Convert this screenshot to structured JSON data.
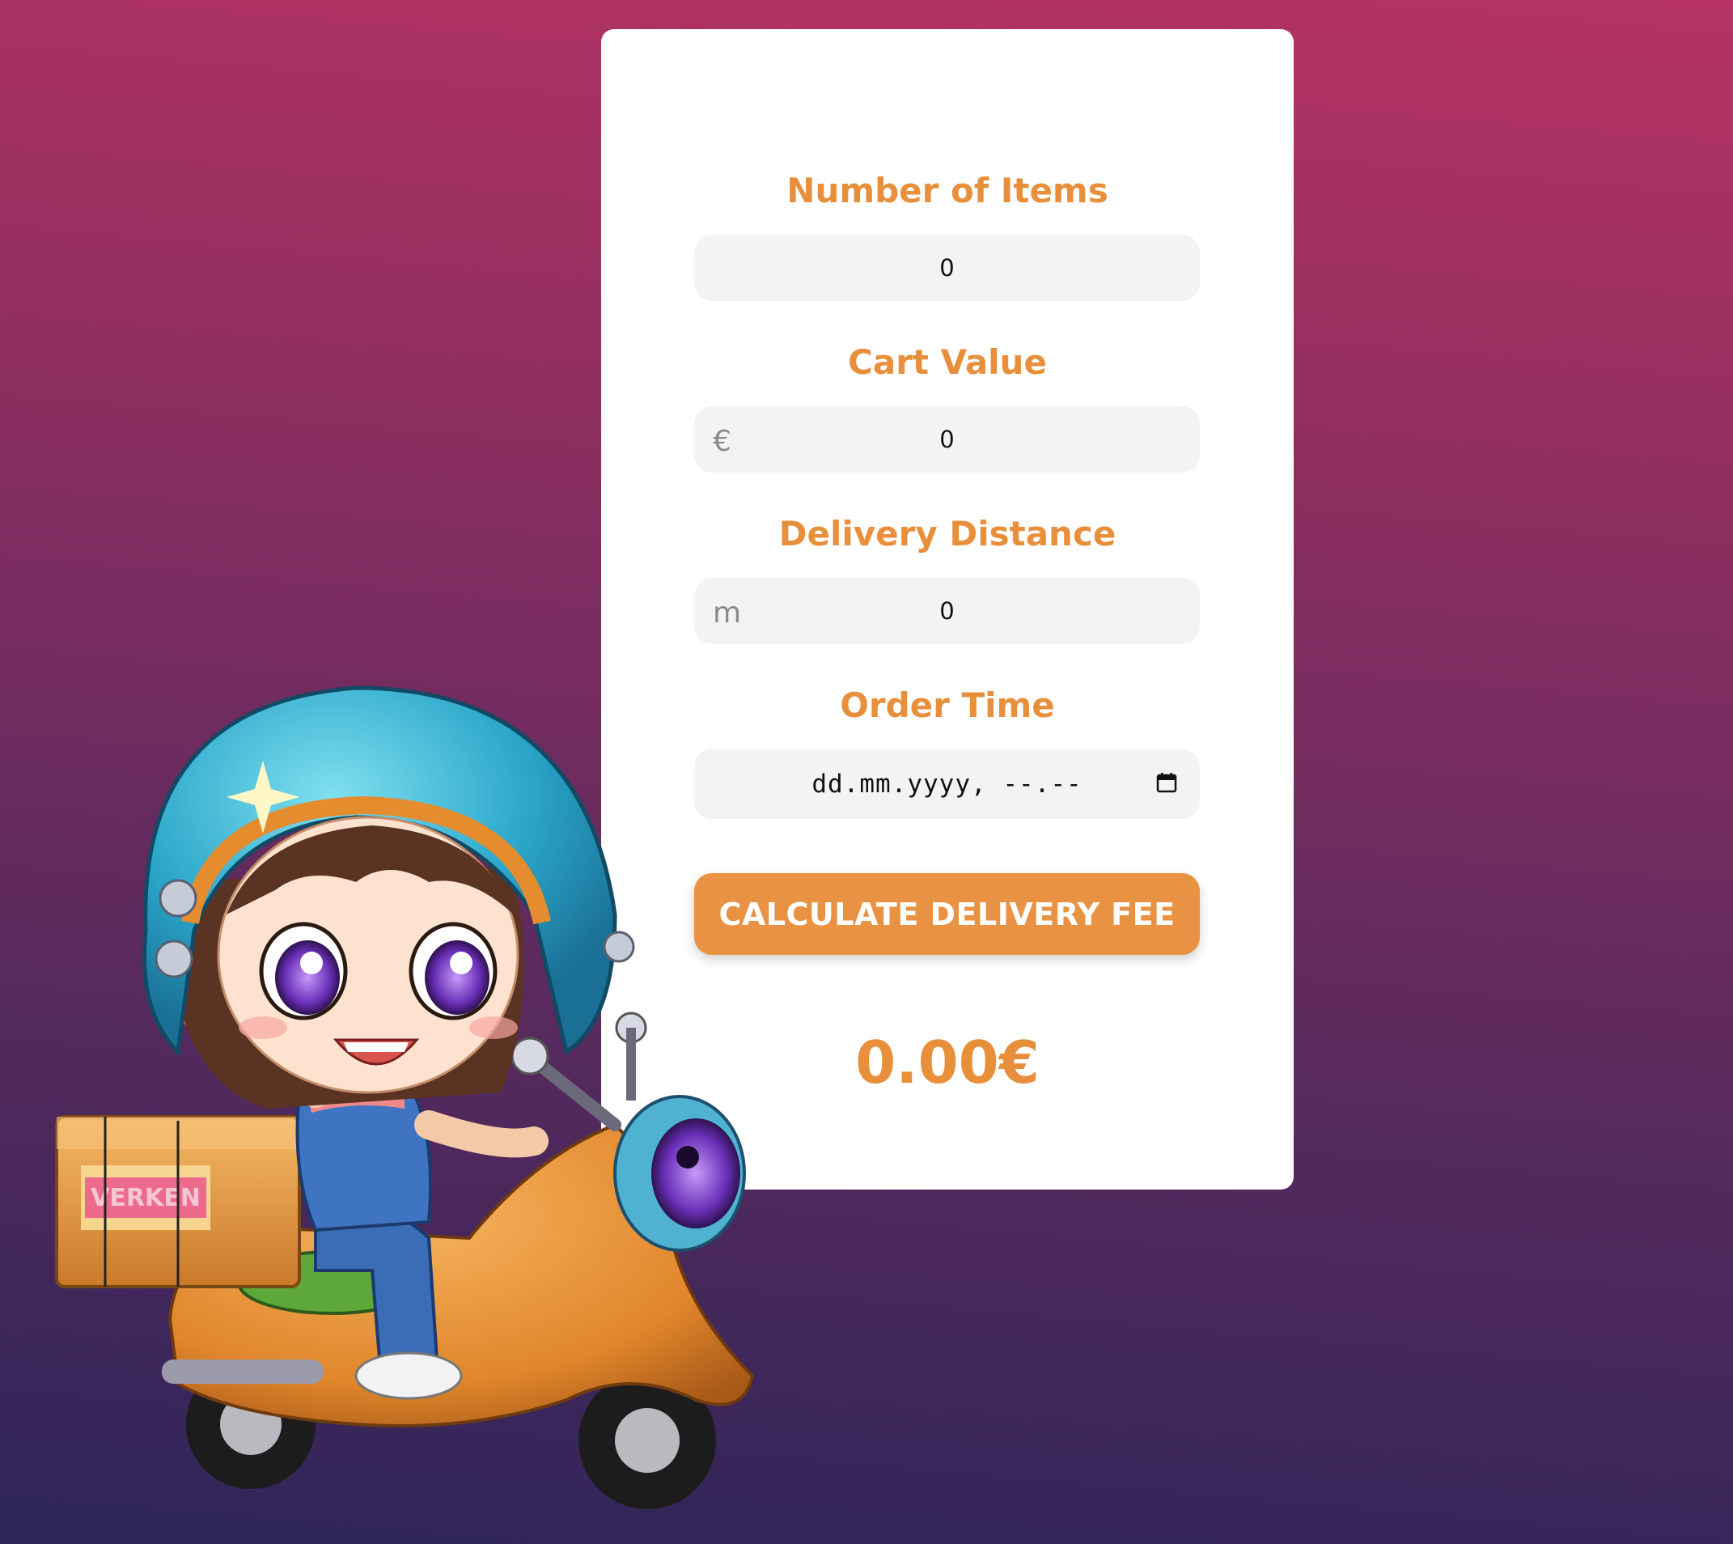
{
  "form": {
    "items": {
      "label": "Number of Items",
      "value": "0"
    },
    "cart": {
      "label": "Cart Value",
      "unit": "€",
      "value": "0"
    },
    "distance": {
      "label": "Delivery Distance",
      "unit": "m",
      "value": "0"
    },
    "time": {
      "label": "Order Time",
      "value": "dd.mm.yyyy, --.--"
    },
    "button_label": "CALCULATE DELIVERY FEE",
    "result": "0.00€"
  },
  "colors": {
    "accent": "#e88f3c",
    "button": "#ea9243",
    "input_bg": "#f2f4f3",
    "card_bg": "#ffffff"
  },
  "icons": {
    "calendar": "calendar-icon"
  },
  "mascot": {
    "box_text": "VERKEN"
  }
}
